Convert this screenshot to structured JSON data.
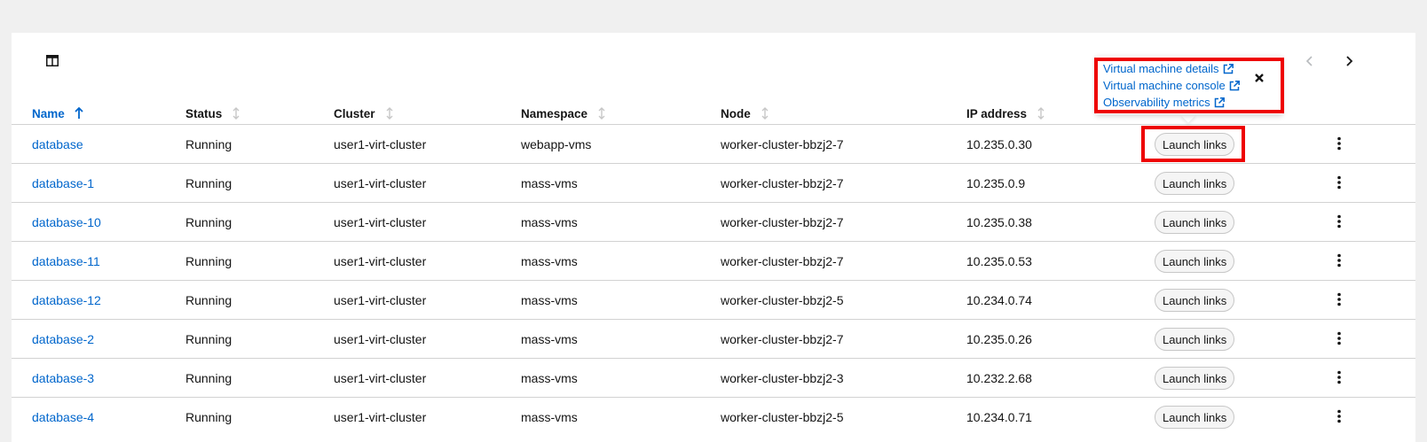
{
  "toolbar": {
    "columns_icon": "columns-manage-icon",
    "prev_icon": "chevron-left-icon",
    "next_icon": "chevron-right-icon"
  },
  "table": {
    "headers": [
      "Name",
      "Status",
      "Cluster",
      "Namespace",
      "Node",
      "IP address"
    ],
    "sorted_column": "Name",
    "sort_direction": "ascending",
    "rows": [
      {
        "name": "database",
        "status": "Running",
        "cluster": "user1-virt-cluster",
        "namespace": "webapp-vms",
        "node": "worker-cluster-bbzj2-7",
        "ip": "10.235.0.30",
        "action": "Launch links"
      },
      {
        "name": "database-1",
        "status": "Running",
        "cluster": "user1-virt-cluster",
        "namespace": "mass-vms",
        "node": "worker-cluster-bbzj2-7",
        "ip": "10.235.0.9",
        "action": "Launch links"
      },
      {
        "name": "database-10",
        "status": "Running",
        "cluster": "user1-virt-cluster",
        "namespace": "mass-vms",
        "node": "worker-cluster-bbzj2-7",
        "ip": "10.235.0.38",
        "action": "Launch links"
      },
      {
        "name": "database-11",
        "status": "Running",
        "cluster": "user1-virt-cluster",
        "namespace": "mass-vms",
        "node": "worker-cluster-bbzj2-7",
        "ip": "10.235.0.53",
        "action": "Launch links"
      },
      {
        "name": "database-12",
        "status": "Running",
        "cluster": "user1-virt-cluster",
        "namespace": "mass-vms",
        "node": "worker-cluster-bbzj2-5",
        "ip": "10.234.0.74",
        "action": "Launch links"
      },
      {
        "name": "database-2",
        "status": "Running",
        "cluster": "user1-virt-cluster",
        "namespace": "mass-vms",
        "node": "worker-cluster-bbzj2-7",
        "ip": "10.235.0.26",
        "action": "Launch links"
      },
      {
        "name": "database-3",
        "status": "Running",
        "cluster": "user1-virt-cluster",
        "namespace": "mass-vms",
        "node": "worker-cluster-bbzj2-3",
        "ip": "10.232.2.68",
        "action": "Launch links"
      },
      {
        "name": "database-4",
        "status": "Running",
        "cluster": "user1-virt-cluster",
        "namespace": "mass-vms",
        "node": "worker-cluster-bbzj2-5",
        "ip": "10.234.0.71",
        "action": "Launch links"
      }
    ]
  },
  "popover": {
    "links": [
      "Virtual machine details",
      "Virtual machine console",
      "Observability metrics"
    ],
    "link_icon": "external-link-icon",
    "close_icon": "close-icon"
  },
  "colors": {
    "link": "#0066cc",
    "highlight": "#ee0000",
    "background": "#f0f0f0"
  }
}
